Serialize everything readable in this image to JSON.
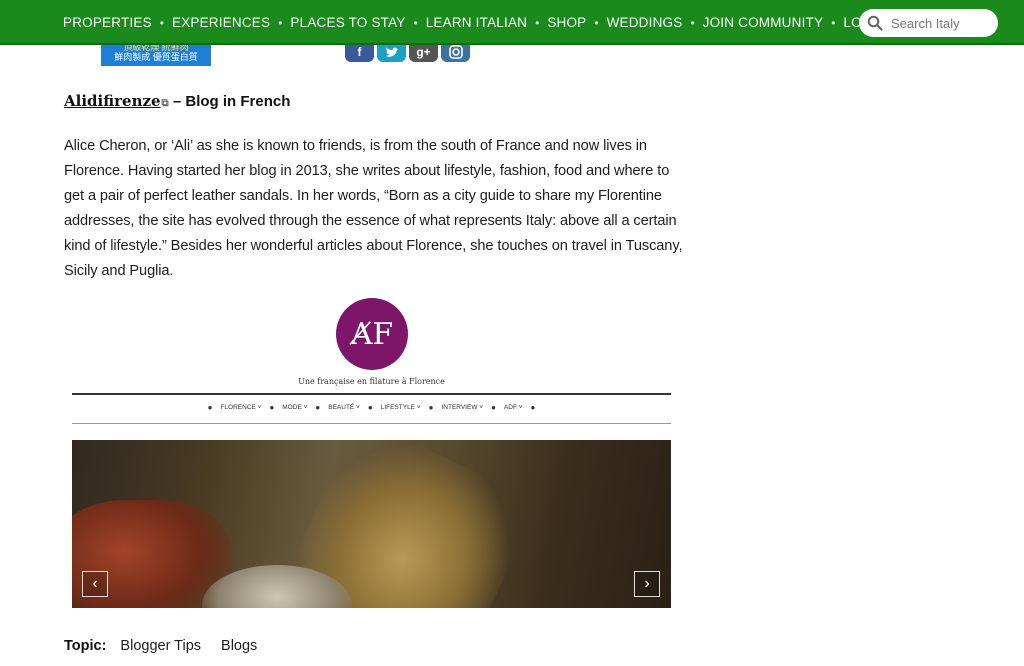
{
  "nav": {
    "items": [
      {
        "label": "PROPERTIES"
      },
      {
        "label": "EXPERIENCES"
      },
      {
        "label": "PLACES TO STAY"
      },
      {
        "label": "LEARN ITALIAN"
      },
      {
        "label": "SHOP"
      },
      {
        "label": "WEDDINGS"
      },
      {
        "label": "JOIN COMMUNITY"
      },
      {
        "label": "LOGIN"
      }
    ],
    "separator": "•",
    "search_placeholder": "Search Italy"
  },
  "top_fragment": {
    "ad_line1": "頂級乾燥 統鮮肉",
    "ad_line2": "鮮肉製成 優質蛋白質"
  },
  "social": [
    "facebook-icon",
    "twitter-icon",
    "google-plus-icon",
    "instagram-icon"
  ],
  "article": {
    "title_link": "Alidifirenze",
    "title_rest": " – Blog in French",
    "paragraph": "Alice Cheron, or ‘Ali’ as she is known to friends, is from the south of France and now lives in Florence. Having started her blog in 2013, she writes about lifestyle, fashion, food and where to get a pair of perfect leather sandals. In her words, “Born as a city guide to share my Florentine addresses, the site has evolved through the essence of what represents Italy: above all a certain kind of lifestyle.” Besides her wonderful articles about Florence, she touches on travel in Tuscany, Sicily and Puglia."
  },
  "blog_screenshot": {
    "logo_text": "A̸F",
    "tagline": "Une française en filature à Florence",
    "nav": [
      "FLORENCE ˅",
      "MODE ˅",
      "BEAUTÉ ˅",
      "LIFESTYLE ˅",
      "INTERVIEW ˅",
      "ADF ˅"
    ],
    "prev_label": "‹",
    "next_label": "›"
  },
  "topics": {
    "label": "Topic:",
    "items": [
      "Blogger Tips",
      "Blogs"
    ]
  },
  "colors": {
    "nav_bg": "#1a8a1c",
    "logo_purple": "#7d1668"
  }
}
